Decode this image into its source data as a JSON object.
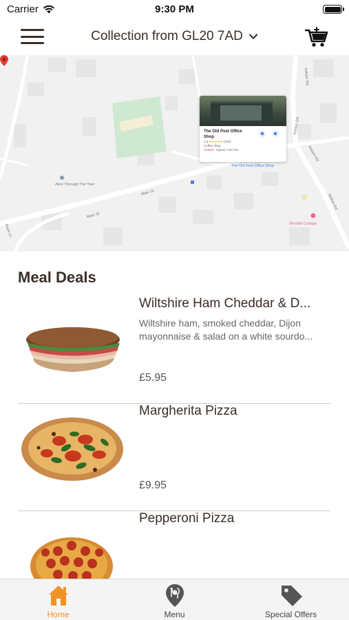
{
  "status_bar": {
    "carrier": "Carrier",
    "time": "9:30 PM"
  },
  "nav": {
    "title": "Collection from GL20 7AD",
    "menu_icon": "hamburger-icon",
    "cart_icon": "cart-icon"
  },
  "map": {
    "labels": {
      "place_1": "Alice Through The Year",
      "place_2": "Windfall Cottage",
      "road_1": "Main St",
      "road_2": "Main St",
      "road_3": "Back Ln",
      "road_4": "Ashton Rd",
      "road_5": "Station Rd",
      "road_6": "Station Rd",
      "road_7": "Ashton Rd"
    },
    "card": {
      "name": "The Old Post Office Shop",
      "rating": "4.6",
      "stars": "★★★★★",
      "reviews": "(150)",
      "category": "Coffee shop",
      "status": "Closed",
      "hours": "· Opens 7AM Thu"
    },
    "pin_label": "The Old Post Office Shop"
  },
  "section": {
    "title": "Meal Deals"
  },
  "items": [
    {
      "name": "Wiltshire Ham Cheddar & D...",
      "description": "Wiltshire ham, smoked cheddar, Dijon mayonnaise & salad on a white sourdo...",
      "price": "£5.95"
    },
    {
      "name": "Margherita Pizza",
      "description": "",
      "price": "£9.95"
    },
    {
      "name": "Pepperoni Pizza",
      "description": "",
      "price": ""
    }
  ],
  "tabs": [
    {
      "label": "Home",
      "icon": "home-icon",
      "active": true
    },
    {
      "label": "Menu",
      "icon": "map-marker-icon",
      "active": false
    },
    {
      "label": "Special Offers",
      "icon": "tag-icon",
      "active": false
    }
  ],
  "colors": {
    "accent": "#f09327",
    "text_dark": "#3a2e28",
    "tab_bar_bg": "#f4f4f4"
  }
}
